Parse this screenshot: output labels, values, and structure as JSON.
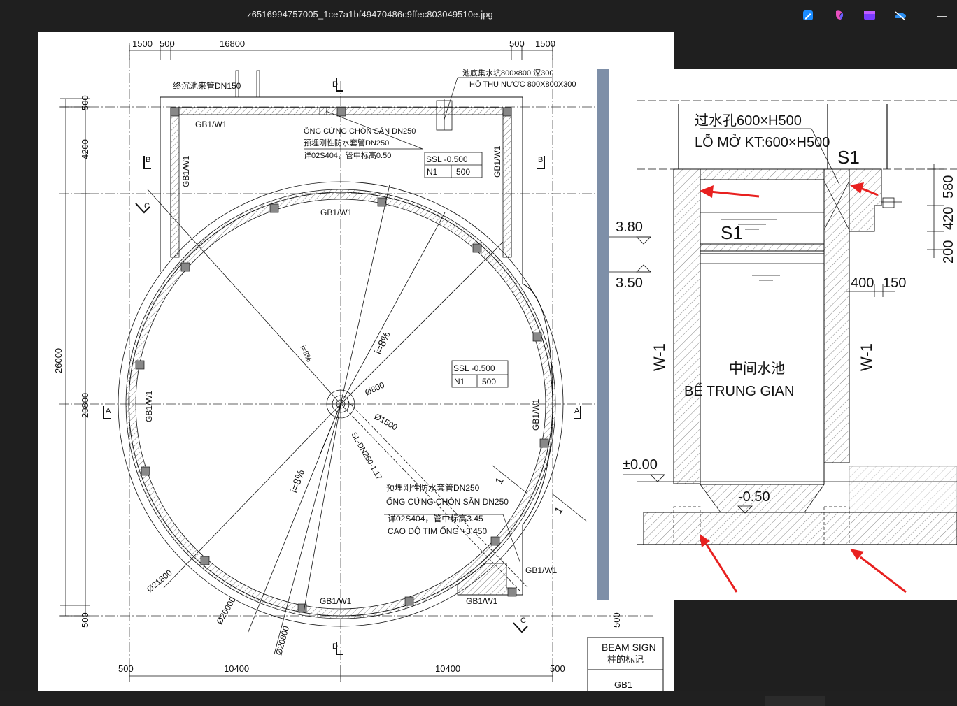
{
  "window": {
    "title": "z6516994757005_1ce7a1bf49470486c9ffec803049510e.jpg",
    "toolbar_icons": [
      "edit-icon",
      "copilot-icon",
      "clipchamp-icon",
      "onedrive-icon"
    ],
    "minimize_symbol": "—"
  },
  "plan": {
    "dims_top": [
      "1500",
      "500",
      "16800",
      "500",
      "1500"
    ],
    "dims_bottom": [
      "500",
      "10400",
      "10400",
      "500"
    ],
    "dims_left": [
      "500",
      "4200",
      "26000",
      "20800",
      "500"
    ],
    "dim_right_bottom": "500",
    "pipe_top_label": "终沉池来管DN150",
    "sump_cn": "池底集水坑800×800 深300",
    "sump_vn": "HỐ THU NƯỚC 800X800X300",
    "sleeve_top_vn": "ỐNG CỨNG CHÔN SẴN DN250",
    "sleeve_top_cn": "预埋刚性防水套管DN250",
    "sleeve_top_ref": "详02S404，管中标高0.50",
    "ssl_top": "SSL -0.500",
    "n1_top": "N1",
    "n1_top_value": "500",
    "ssl_mid": "SSL -0.500",
    "n1_mid": "N1",
    "n1_mid_value": "500",
    "wall_label": "GB1/W1",
    "slope": "i=8%",
    "slope_small": "i=8%",
    "dia_800": "Ø800",
    "dia_1500": "Ø1500",
    "dia_21800": "Ø21800",
    "dia_20000": "Ø20000",
    "dia_20800": "Ø20800",
    "sludge_pipe": "SL-DN250-1.17",
    "sleeve_bot_cn": "预埋刚性防水套管DN250",
    "sleeve_bot_vn": "ỐNG CỨNG CHÔN SẴN DN250",
    "sleeve_bot_ref": "详02S404，管中标高3.45",
    "sleeve_bot_level": "CAO ĐỘ TIM ỐNG +3.450",
    "slope_mark": "1",
    "section_a": "A",
    "section_b": "B",
    "section_c": "C",
    "section_d": "D",
    "legend_title_en": "BEAM SIGN",
    "legend_title_cn": "柱的标记",
    "legend_item": "GB1"
  },
  "section": {
    "opening_cn": "过水孔600×H500",
    "opening_vn": "LỖ MỞ KT:600×H500",
    "s1": "S1",
    "lvl_380": "3.80",
    "lvl_350": "3.50",
    "lvl_000": "±0.00",
    "lvl_050": "-0.50",
    "dim_580": "580",
    "dim_420": "420",
    "dim_200": "200",
    "dim_400": "400",
    "dim_150": "150",
    "wall": "W-1",
    "tank_cn": "中间水池",
    "tank_vn": "BỂ TRUNG GIAN"
  },
  "colors": {
    "arrow": "#e8201f",
    "hatch": "#444444",
    "app_bg": "#1f1f1f"
  }
}
